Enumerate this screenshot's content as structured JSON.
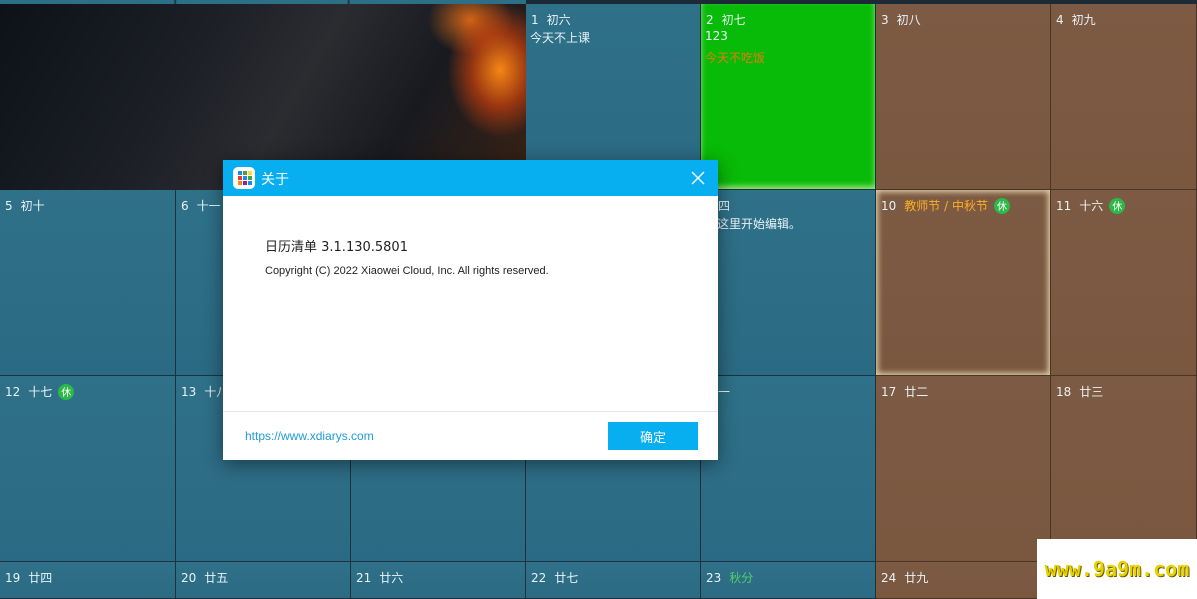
{
  "calendar": {
    "cells": [
      {
        "id": "d1",
        "num": "1",
        "lunar": "初六",
        "notes": [
          {
            "text": "今天不上课",
            "cls": ""
          }
        ]
      },
      {
        "id": "d2",
        "num": "2",
        "lunar": "初七",
        "notes": [
          {
            "text": "123",
            "cls": ""
          },
          {
            "text": "今天不吃饭",
            "cls": "note-orange"
          }
        ]
      },
      {
        "id": "d3",
        "num": "3",
        "lunar": "初八",
        "notes": []
      },
      {
        "id": "d4",
        "num": "4",
        "lunar": "初九",
        "notes": []
      },
      {
        "id": "d5",
        "num": "5",
        "lunar": "初十",
        "notes": []
      },
      {
        "id": "d6",
        "num": "6",
        "lunar": "十一",
        "notes": []
      },
      {
        "id": "d9",
        "num": "",
        "lunar": "十四",
        "notes": [
          {
            "text": "击这里开始编辑。",
            "cls": ""
          }
        ]
      },
      {
        "id": "d10",
        "num": "10",
        "lunar": "教师节 / 中秋节",
        "festival": true,
        "rest": "休",
        "notes": []
      },
      {
        "id": "d11",
        "num": "11",
        "lunar": "十六",
        "rest": "休",
        "notes": []
      },
      {
        "id": "d12",
        "num": "12",
        "lunar": "十七",
        "rest": "休",
        "notes": []
      },
      {
        "id": "d13",
        "num": "13",
        "lunar": "十八",
        "notes": []
      },
      {
        "id": "d16",
        "num": "",
        "lunar": "廿一",
        "notes": []
      },
      {
        "id": "d17",
        "num": "17",
        "lunar": "廿二",
        "notes": []
      },
      {
        "id": "d18",
        "num": "18",
        "lunar": "廿三",
        "notes": []
      },
      {
        "id": "d19",
        "num": "19",
        "lunar": "廿四",
        "notes": []
      },
      {
        "id": "d20",
        "num": "20",
        "lunar": "廿五",
        "notes": []
      },
      {
        "id": "d21",
        "num": "21",
        "lunar": "廿六",
        "notes": []
      },
      {
        "id": "d22",
        "num": "22",
        "lunar": "廿七",
        "notes": []
      },
      {
        "id": "d23",
        "num": "23",
        "lunar": "秋分",
        "solar": true,
        "notes": []
      },
      {
        "id": "d24",
        "num": "24",
        "lunar": "廿九",
        "notes": []
      }
    ]
  },
  "dialog": {
    "title": "关于",
    "product": "日历清单  3.1.130.5801",
    "copyright": "Copyright (C) 2022 Xiaowei Cloud, Inc. All rights reserved.",
    "link": "https://www.xdiarys.com",
    "ok_label": "确定"
  },
  "watermark": "www.9a9m.com",
  "colors": {
    "accent": "#07aef0",
    "cell_blue": "#2e6f88",
    "cell_brown": "#7d5a43",
    "cell_green": "#08bb08",
    "rest_badge": "#2db84a",
    "festival": "#ffb020"
  },
  "icons": {
    "app": "calendar-grid-icon",
    "close": "close-icon"
  }
}
